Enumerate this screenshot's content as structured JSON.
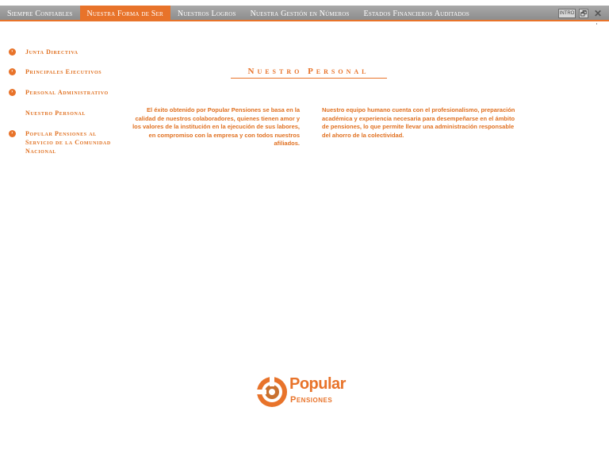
{
  "nav": {
    "tabs": [
      {
        "label": "Siempre Confiables"
      },
      {
        "label": "Nuestra Forma de Ser"
      },
      {
        "label": "Nuestros Logros"
      },
      {
        "label": "Nuestra Gestión en Números"
      },
      {
        "label": "Estados Financieros Auditados"
      }
    ],
    "active_tab": "Nuestra Forma de Ser",
    "controls": {
      "intro": "INTRO",
      "restore": "🗗",
      "close": "✕"
    }
  },
  "menu": {
    "items": [
      {
        "label": "Junta Directiva",
        "bullet": "›"
      },
      {
        "label": "Principales Ejecutivos",
        "bullet": "›"
      },
      {
        "label": "Personal Administrativo",
        "bullet": "›"
      },
      {
        "label": "Nuestro Personal"
      },
      {
        "label": "Popular Pensiones al Servicio de la Comunidad Nacional",
        "bullet": "›"
      }
    ]
  },
  "section": {
    "title": "Nuestro Personal",
    "subtitle": "",
    "para_left": "El éxito obtenido por Popular Pensiones se basa en la calidad de nuestros colaboradores, quienes tienen amor y los valores de la institución en la ejecución de sus labores, en compromiso con la empresa y con todos nuestros afiliados.",
    "para_right": "Nuestro equipo humano cuenta con el profesionalismo, preparación académica y experiencia necesaria para desempeñarse en el ámbito de pensiones, lo que permite llevar una administración responsable del ahorro de la colectividad."
  },
  "logo": {
    "word1": "Popular",
    "word2": "Pensiones"
  },
  "colors": {
    "accent": "#e8732a",
    "nav_bg": "#9b9b9b",
    "text": "#e07020"
  }
}
